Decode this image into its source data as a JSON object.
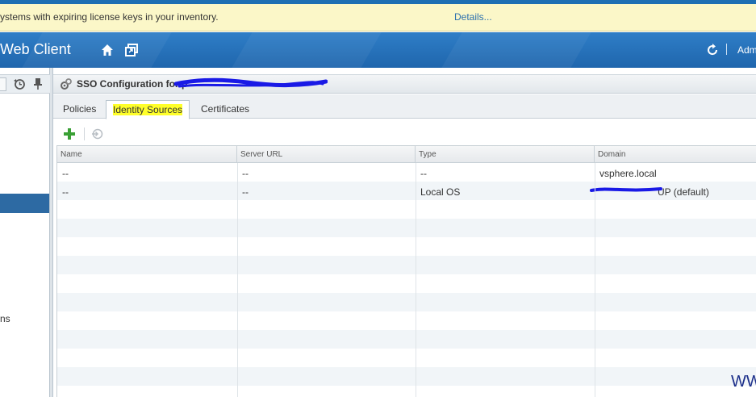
{
  "notice": {
    "message": "ystems with expiring license keys in your inventory.",
    "details_link": "Details..."
  },
  "header": {
    "app_title": "Web Client",
    "user": "Adm"
  },
  "navigator": {
    "partial_item": "ns"
  },
  "panel": {
    "title": "SSO Configuration for p",
    "tabs": [
      {
        "label": "Policies",
        "active": false
      },
      {
        "label": "Identity Sources",
        "active": true
      },
      {
        "label": "Certificates",
        "active": false
      }
    ]
  },
  "grid": {
    "columns": [
      "Name",
      "Server URL",
      "Type",
      "Domain"
    ],
    "rows": [
      {
        "name": "--",
        "server_url": "--",
        "type": "--",
        "domain": "vsphere.local"
      },
      {
        "name": "--",
        "server_url": "--",
        "type": "Local OS",
        "domain": "UP (default)"
      }
    ]
  },
  "watermark": "WW",
  "colors": {
    "header_blue": "#2f7ec7",
    "notice_bg": "#fbf7c8",
    "selected_nav": "#2d6aa3",
    "highlight": "#ffff2a",
    "redaction": "#1a1ae6"
  },
  "icons": [
    "home-icon",
    "new-window-icon",
    "refresh-icon",
    "history-icon",
    "pin-icon",
    "sso-config-icon",
    "add-icon",
    "join-icon"
  ]
}
